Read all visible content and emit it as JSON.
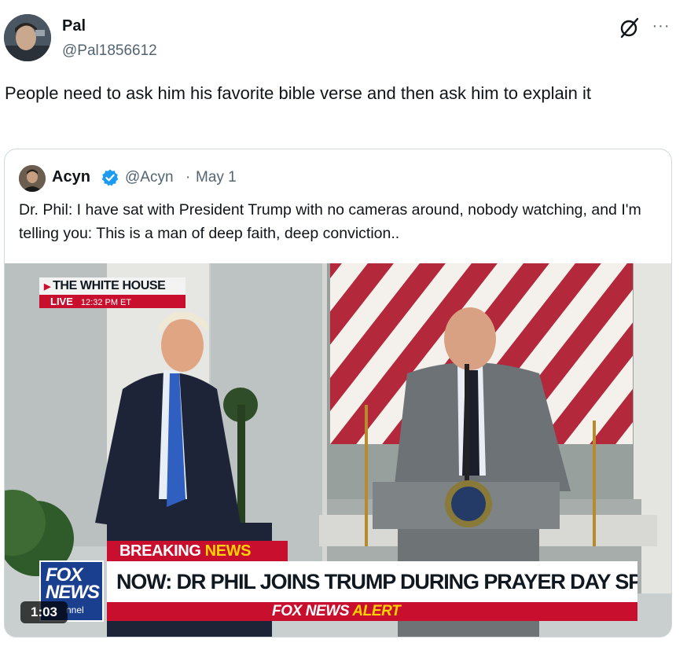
{
  "post": {
    "author_name": "Pal",
    "author_handle": "@Pal1856612",
    "text": "People need to ask him his favorite bible verse and then ask him to explain it",
    "more_label": "···",
    "grok_icon": "grok-icon"
  },
  "quote": {
    "author_name": "Acyn",
    "verified": true,
    "verified_color": "#1d9bf0",
    "author_handle": "@Acyn",
    "separator": "·",
    "date": "May 1",
    "text": "Dr. Phil: I have sat with President Trump with no cameras around, nobody watching, and I'm telling you: This is a man of deep faith, deep conviction.."
  },
  "video": {
    "live_location": "THE WHITE HOUSE",
    "live_label": "LIVE",
    "live_time": "12:32 PM ET",
    "breaking_prefix": "BREAKING",
    "breaking_suffix": "NEWS",
    "headline": "NOW: DR PHIL JOINS TRUMP DURING PRAYER DAY SPEECH",
    "alert_brand": "FOX NEWS",
    "alert_word": "ALERT",
    "logo_line1": "FOX",
    "logo_line2": "NEWS",
    "logo_line3": "nnel",
    "duration": "1:03"
  },
  "colors": {
    "text_primary": "#0f1419",
    "text_secondary": "#536471",
    "border": "#cfd9de",
    "fox_red": "#c8102e",
    "fox_yellow": "#ffd200",
    "fox_blue": "#1b3f8f"
  }
}
